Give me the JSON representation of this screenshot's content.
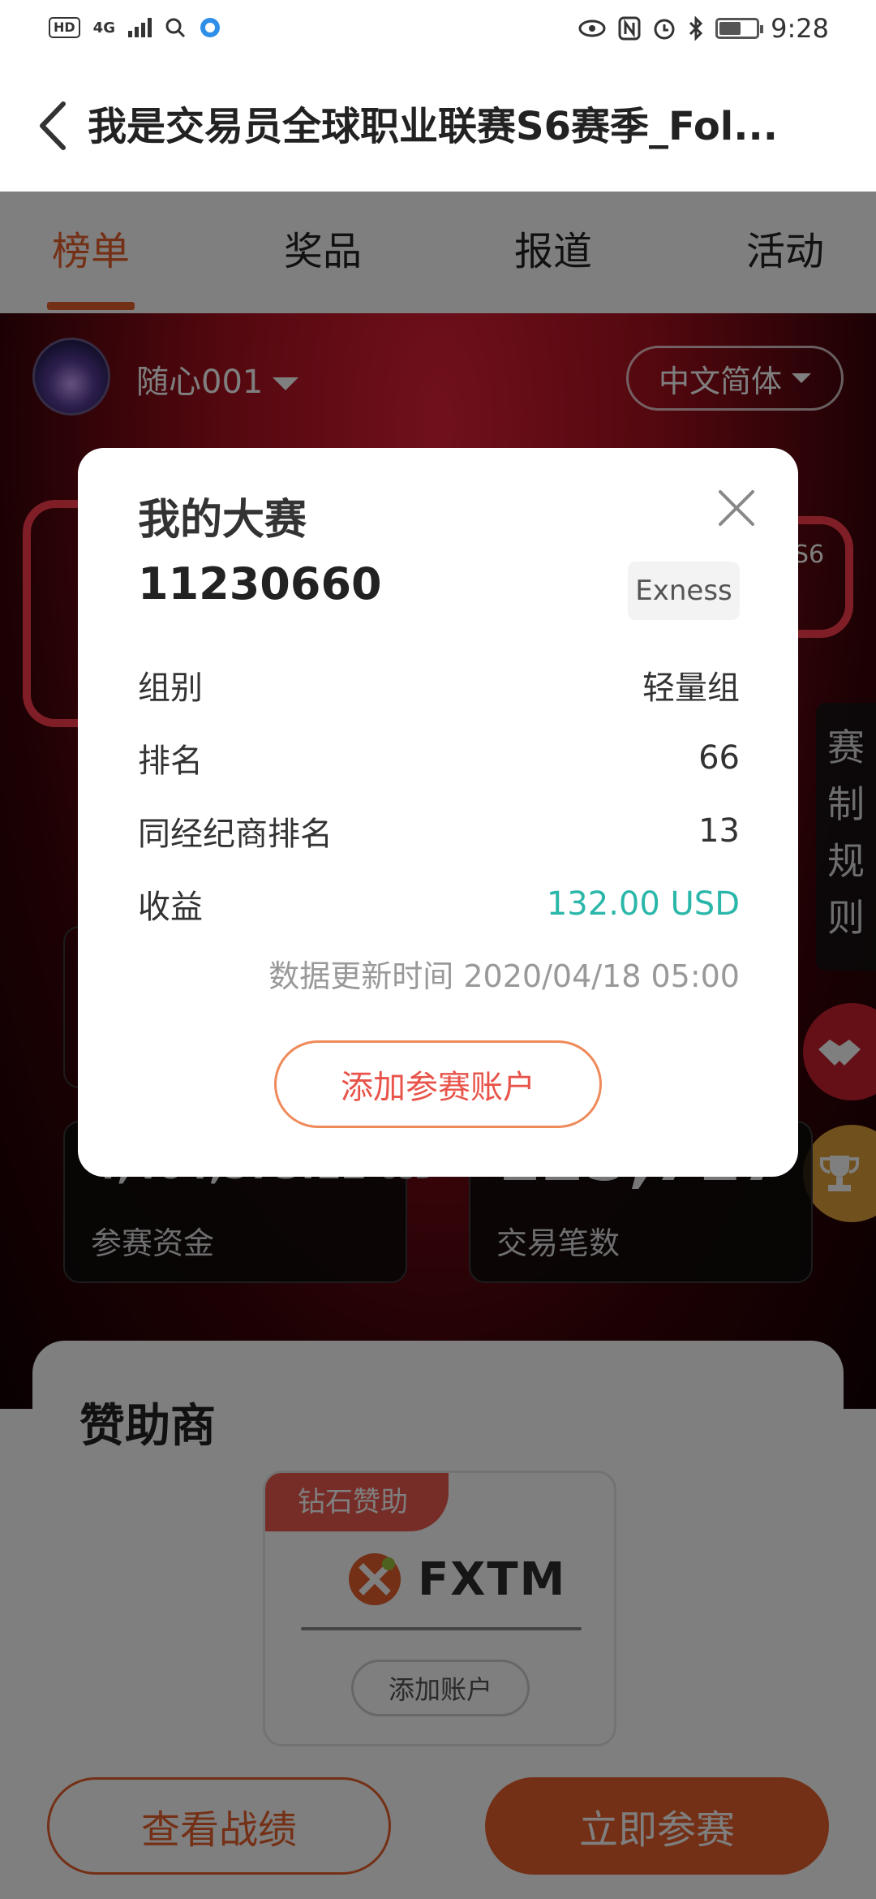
{
  "status_bar": {
    "hd": "HD",
    "network": "4G",
    "time": "9:28",
    "icons": [
      "eye-icon",
      "nfc-icon",
      "alarm-icon",
      "bluetooth-icon",
      "battery-icon"
    ]
  },
  "header": {
    "title": "我是交易员全球职业联赛S6赛季_Fol..."
  },
  "tabs": [
    {
      "label": "榜单",
      "active": true
    },
    {
      "label": "奖品",
      "active": false
    },
    {
      "label": "报道",
      "active": false
    },
    {
      "label": "活动",
      "active": false
    }
  ],
  "hero": {
    "username": "随心001",
    "language": "中文简体",
    "rules_tab": "赛制规则",
    "emblem_text": "S6",
    "stats": [
      {
        "value": "4,464,573.12",
        "unit": "USD",
        "label": "参赛资金"
      },
      {
        "value": "125,717",
        "label": "交易笔数"
      }
    ]
  },
  "sponsor": {
    "title": "赞助商",
    "badge": "钻石赞助",
    "brand": "FXTM",
    "add_account": "添加账户"
  },
  "bottom": {
    "view_record": "查看战绩",
    "join_now": "立即参赛"
  },
  "modal": {
    "title": "我的大赛",
    "account_no": "11230660",
    "broker": "Exness",
    "rows": [
      {
        "label": "组别",
        "value": "轻量组"
      },
      {
        "label": "排名",
        "value": "66"
      },
      {
        "label": "同经纪商排名",
        "value": "13"
      },
      {
        "label": "收益",
        "value": "132.00 USD"
      }
    ],
    "update_time": "数据更新时间 2020/04/18 05:00",
    "add_button": "添加参赛账户"
  },
  "colors": {
    "accent": "#e8612c",
    "profit_green": "#2ab7a9",
    "hero_red": "#c8182c"
  }
}
